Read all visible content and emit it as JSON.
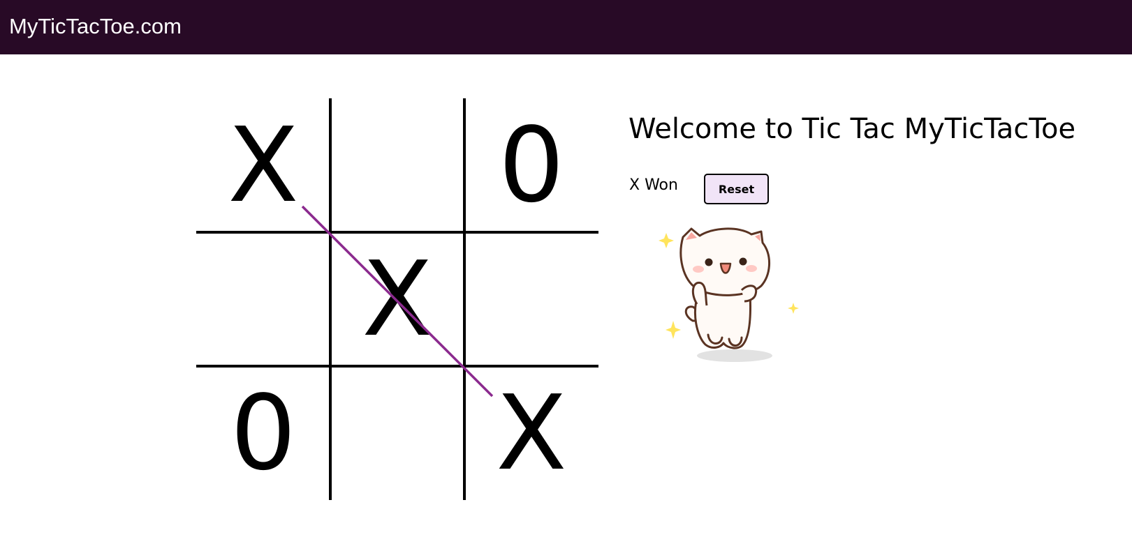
{
  "navbar": {
    "brand": "MyTicTacToe.com"
  },
  "board": {
    "cells": [
      "X",
      "",
      "0",
      "",
      "X",
      "",
      "0",
      "",
      "X"
    ],
    "winning_line": "diagonal-top-left-to-bottom-right",
    "win_color": "#8b2a8e"
  },
  "panel": {
    "welcome": "Welcome to Tic Tac MyTicTacToe",
    "status": "X Won",
    "reset_label": "Reset"
  },
  "colors": {
    "navbar": "#280a26",
    "button_bg": "#f1e4f7"
  },
  "celebration_image": "cat-cheering-sticker"
}
